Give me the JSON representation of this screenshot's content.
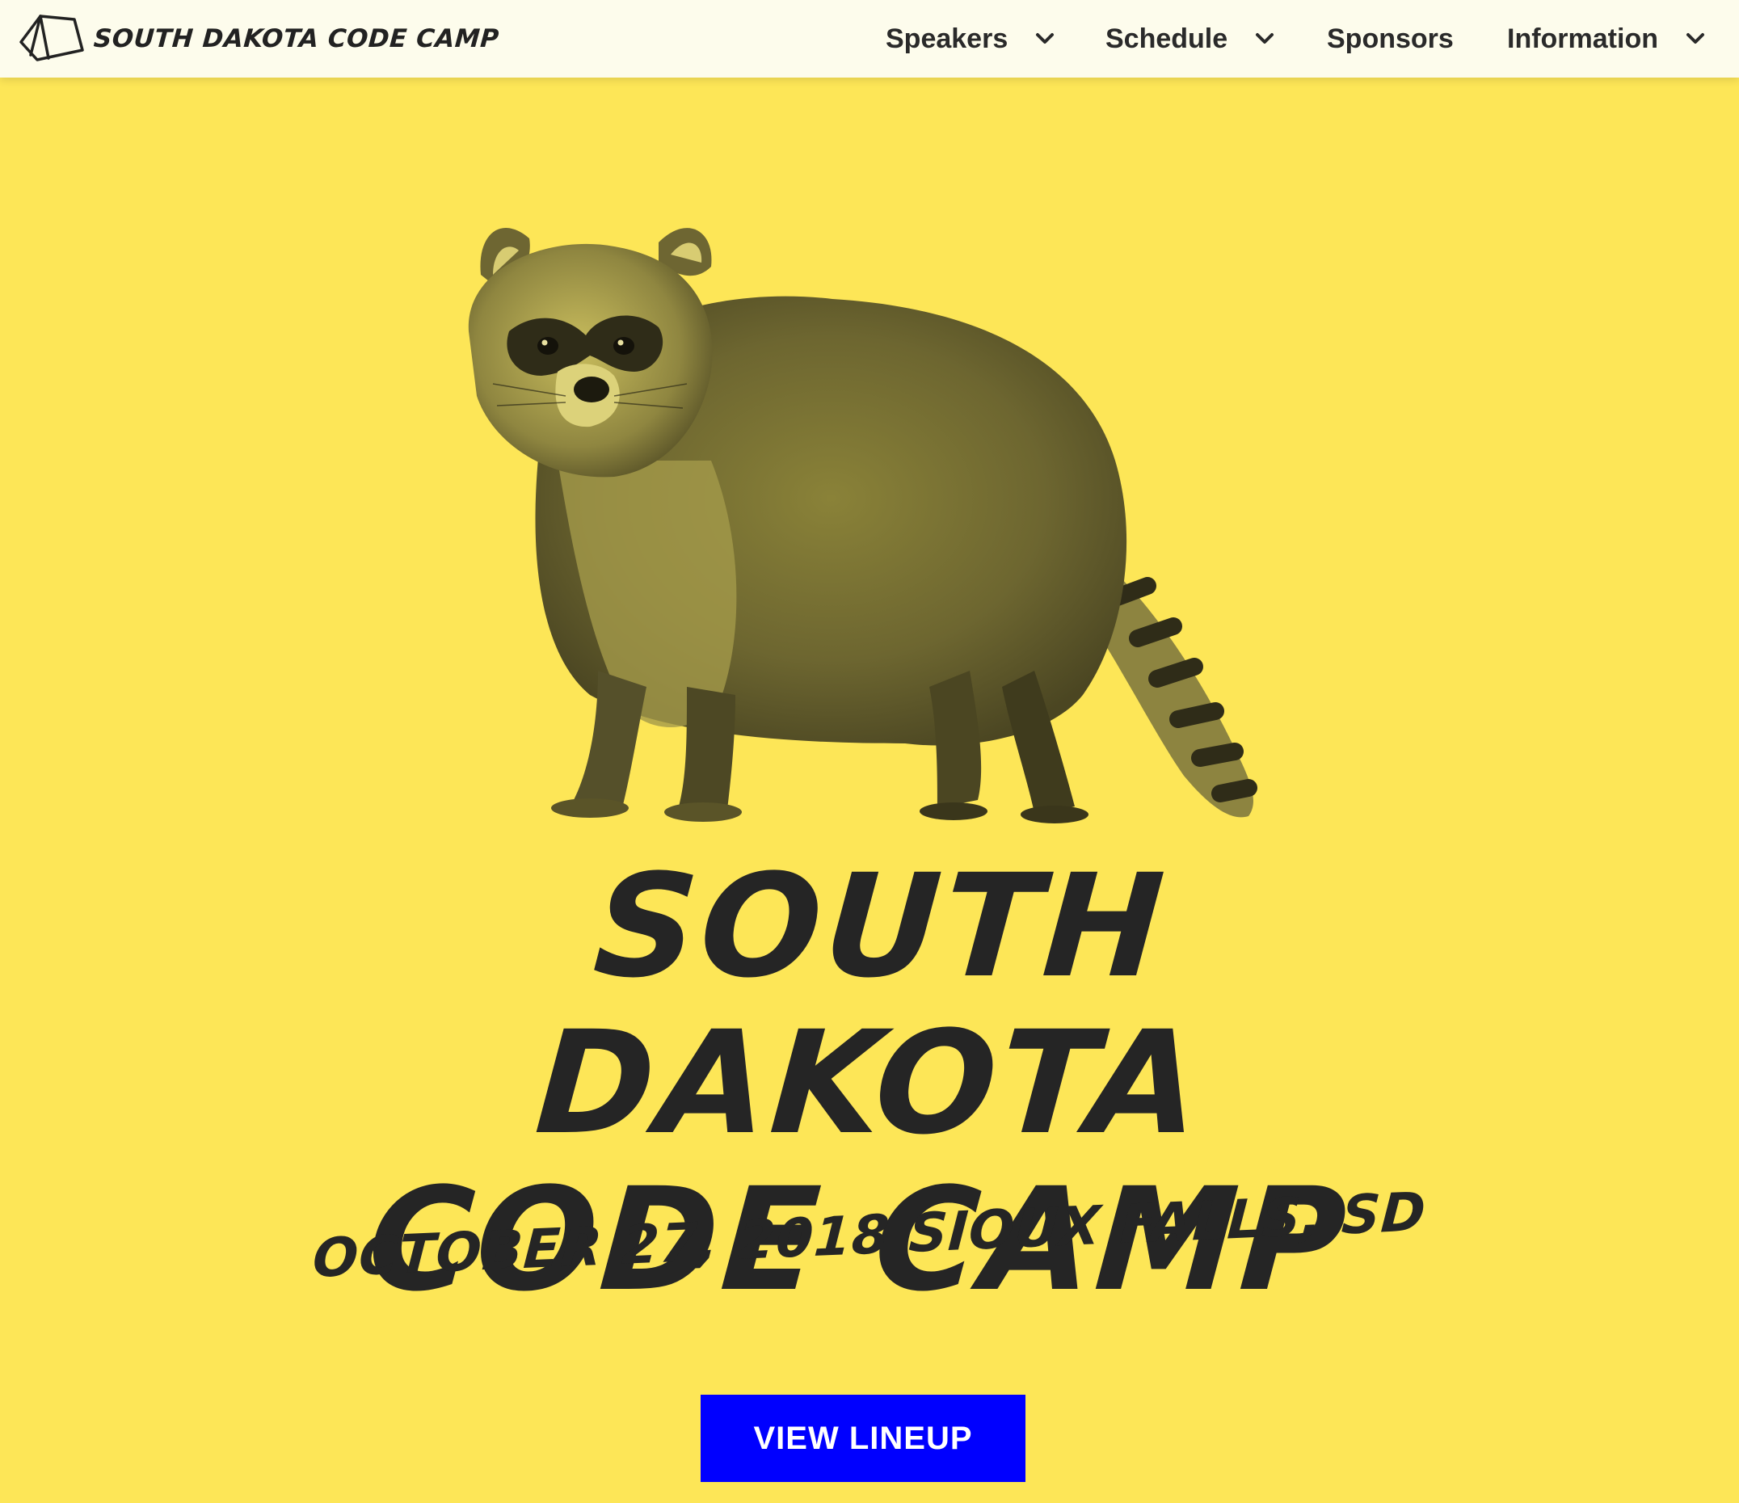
{
  "header": {
    "brand_text": "SOUTH DAKOTA CODE CAMP",
    "brand_icon": "tent-icon",
    "nav": [
      {
        "label": "Speakers",
        "has_dropdown": true
      },
      {
        "label": "Schedule",
        "has_dropdown": true
      },
      {
        "label": "Sponsors",
        "has_dropdown": false
      },
      {
        "label": "Information",
        "has_dropdown": true
      }
    ]
  },
  "hero": {
    "image": "raccoon-illustration",
    "title_line1": "SOUTH DAKOTA",
    "title_line2": "CODE CAMP",
    "subtitle": "OCTOBER 27, 2018 SIOUX FALLS, SD",
    "cta_label": "VIEW LINEUP"
  },
  "colors": {
    "background": "#fde657",
    "navbar": "#fdfcec",
    "text_dark": "#252525",
    "cta": "#0000ff",
    "cta_text": "#ffffff"
  }
}
